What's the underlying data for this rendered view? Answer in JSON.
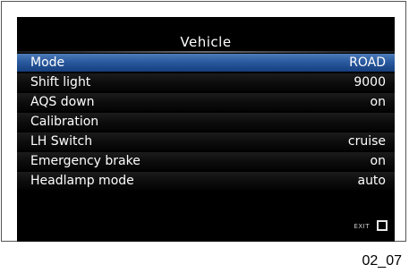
{
  "screen": {
    "title": "Vehicle",
    "items": [
      {
        "label": "Mode",
        "value": "ROAD",
        "selected": true
      },
      {
        "label": "Shift light",
        "value": "9000",
        "selected": false
      },
      {
        "label": "AQS down",
        "value": "on",
        "selected": false
      },
      {
        "label": "Calibration",
        "value": "",
        "selected": false
      },
      {
        "label": "LH Switch",
        "value": "cruise",
        "selected": false
      },
      {
        "label": "Emergency brake",
        "value": "on",
        "selected": false
      },
      {
        "label": "Headlamp mode",
        "value": "auto",
        "selected": false
      }
    ],
    "exit_label": "EXIT"
  },
  "figure_caption": "02_07",
  "colors": {
    "highlight": "#2a5aa0",
    "background": "#000000",
    "text": "#ffffff"
  }
}
